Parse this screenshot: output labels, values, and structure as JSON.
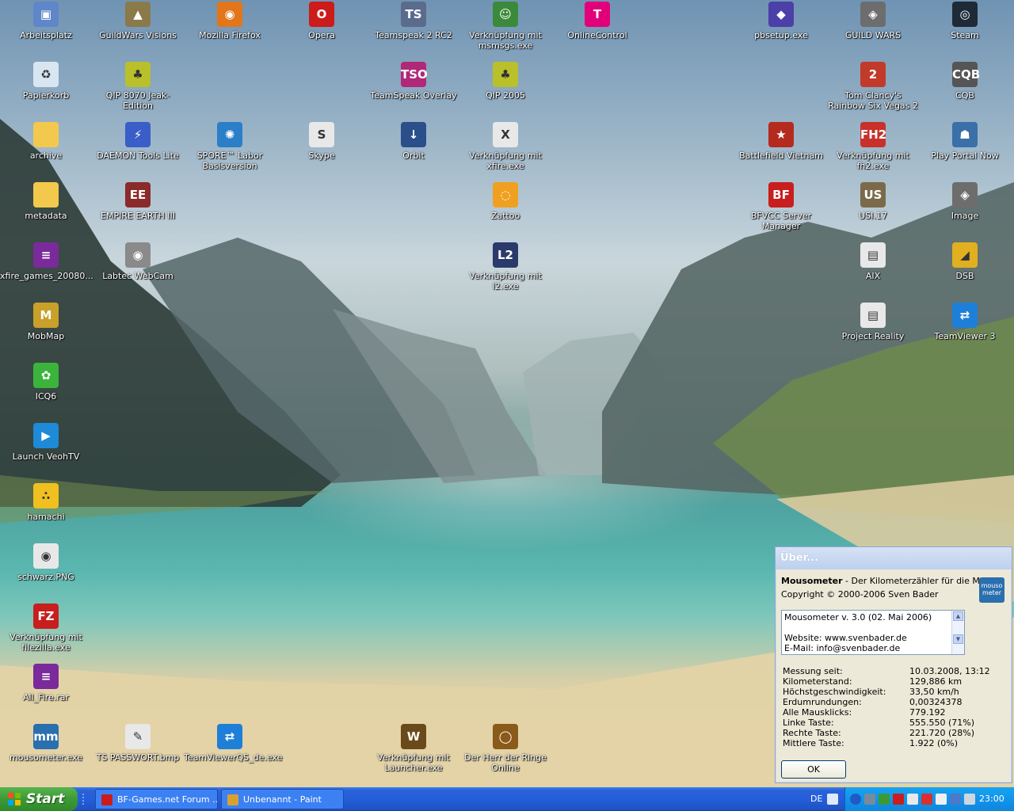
{
  "desktop": {
    "icons": [
      {
        "label": "Arbeitsplatz",
        "icon": "my-computer-icon",
        "glyph": "▣",
        "color": "#5f86c8"
      },
      {
        "label": "GuildWars Visions",
        "icon": "guildwars-visions-icon",
        "glyph": "▲",
        "color": "#8a7a4a"
      },
      {
        "label": "Mozilla Firefox",
        "icon": "firefox-icon",
        "glyph": "◉",
        "color": "#e2761b"
      },
      {
        "label": "Opera",
        "icon": "opera-icon",
        "glyph": "O",
        "color": "#cc1b1b"
      },
      {
        "label": "Teamspeak 2 RC2",
        "icon": "teamspeak-icon",
        "glyph": "TS",
        "color": "#5a6b8c"
      },
      {
        "label": "Verknüpfung mit msmsgs.exe",
        "icon": "messenger-icon",
        "glyph": "☺",
        "color": "#3b8a3b"
      },
      {
        "label": "OnlineControl",
        "icon": "telekom-icon",
        "glyph": "T",
        "color": "#e2007a"
      },
      {
        "label": "pbsetup.exe",
        "icon": "pbsetup-icon",
        "glyph": "◆",
        "color": "#4b3fa8"
      },
      {
        "label": "GUILD WARS",
        "icon": "guild-wars-icon",
        "glyph": "◈",
        "color": "#6d6d6d"
      },
      {
        "label": "Steam",
        "icon": "steam-icon",
        "glyph": "◎",
        "color": "#1e2a38"
      },
      {
        "label": "Papierkorb",
        "icon": "recycle-bin-icon",
        "glyph": "♻",
        "color": "#d8e6f2"
      },
      {
        "label": "QIP 8070 Jeak-Edition",
        "icon": "qip-icon",
        "glyph": "♣",
        "color": "#b9c02a"
      },
      {
        "label": "TeamSpeak Overlay",
        "icon": "teamspeak-overlay-icon",
        "glyph": "TSO",
        "color": "#b02878"
      },
      {
        "label": "QIP 2005",
        "icon": "qip2005-icon",
        "glyph": "♣",
        "color": "#b9c02a"
      },
      {
        "label": "Tom Clancy's Rainbow Six Vegas 2",
        "icon": "rainbow-six-icon",
        "glyph": "2",
        "color": "#c23a2a"
      },
      {
        "label": "CQB",
        "icon": "cqb-icon",
        "glyph": "CQB",
        "color": "#555555"
      },
      {
        "label": "archive",
        "icon": "folder-icon",
        "glyph": "",
        "color": "#f2c94c"
      },
      {
        "label": "DAEMON Tools Lite",
        "icon": "daemon-tools-icon",
        "glyph": "⚡",
        "color": "#3a5ec8"
      },
      {
        "label": "SPORE™ Labor Basisversion",
        "icon": "spore-icon",
        "glyph": "✺",
        "color": "#2a7fc8"
      },
      {
        "label": "Skype",
        "icon": "skype-icon",
        "glyph": "S",
        "color": "#e8e8e8"
      },
      {
        "label": "Orbit",
        "icon": "orbit-icon",
        "glyph": "↓",
        "color": "#2b4f8a"
      },
      {
        "label": "Verknüpfung mit xfire.exe",
        "icon": "xfire-icon",
        "glyph": "X",
        "color": "#e8e8e8"
      },
      {
        "label": "Battlefield Vietnam",
        "icon": "battlefield-vietnam-icon",
        "glyph": "★",
        "color": "#b52a1e"
      },
      {
        "label": "Verknüpfung mit fh2.exe",
        "icon": "fh2-icon",
        "glyph": "FH2",
        "color": "#c8302a"
      },
      {
        "label": "Play Portal Now",
        "icon": "portal-icon",
        "glyph": "☗",
        "color": "#3a6fa8"
      },
      {
        "label": "metadata",
        "icon": "folder-icon",
        "glyph": "",
        "color": "#f2c94c"
      },
      {
        "label": "EMPIRE EARTH III",
        "icon": "empire-earth-icon",
        "glyph": "EE",
        "color": "#8a2a2a"
      },
      {
        "label": "Zattoo",
        "icon": "zattoo-icon",
        "glyph": "◌",
        "color": "#f0a020"
      },
      {
        "label": "BFVCC Server Manager",
        "icon": "bfvcc-icon",
        "glyph": "BF",
        "color": "#c81e1e"
      },
      {
        "label": "USI.17",
        "icon": "usi-icon",
        "glyph": "US",
        "color": "#7a6a4a"
      },
      {
        "label": "Image",
        "icon": "image-icon",
        "glyph": "◈",
        "color": "#6d6d6d"
      },
      {
        "label": "xfire_games_20080...",
        "icon": "winrar-icon",
        "glyph": "≡",
        "color": "#7a2a9a"
      },
      {
        "label": "Labtec WebCam",
        "icon": "webcam-icon",
        "glyph": "◉",
        "color": "#8a8a8a"
      },
      {
        "label": "Verknüpfung mit l2.exe",
        "icon": "lineage2-icon",
        "glyph": "L2",
        "color": "#2a3a6a"
      },
      {
        "label": "AIX",
        "icon": "aix-icon",
        "glyph": "▤",
        "color": "#e8e8e8"
      },
      {
        "label": "DSB",
        "icon": "dsb-icon",
        "glyph": "◢",
        "color": "#e0b020"
      },
      {
        "label": "MobMap",
        "icon": "mobmap-icon",
        "glyph": "M",
        "color": "#c8a02a"
      },
      {
        "label": "Project Reality",
        "icon": "project-reality-icon",
        "glyph": "▤",
        "color": "#e8e8e8"
      },
      {
        "label": "TeamViewer 3",
        "icon": "teamviewer-icon",
        "glyph": "⇄",
        "color": "#1e7fd8"
      },
      {
        "label": "ICQ6",
        "icon": "icq-icon",
        "glyph": "✿",
        "color": "#3cb43c"
      },
      {
        "label": "Launch VeohTV",
        "icon": "veohtv-icon",
        "glyph": "▶",
        "color": "#1e8ad8"
      },
      {
        "label": "hamachi",
        "icon": "hamachi-icon",
        "glyph": "∴",
        "color": "#f0c020"
      },
      {
        "label": "schwarz.PNG",
        "icon": "png-file-icon",
        "glyph": "◉",
        "color": "#e8e8e8"
      },
      {
        "label": "Verknüpfung mit filezilla.exe",
        "icon": "filezilla-icon",
        "glyph": "FZ",
        "color": "#c81e1e"
      },
      {
        "label": "All_Fire.rar",
        "icon": "winrar-icon",
        "glyph": "≡",
        "color": "#7a2a9a"
      },
      {
        "label": "mousometer.exe",
        "icon": "mousometer-icon",
        "glyph": "mm",
        "color": "#2a6fae"
      },
      {
        "label": "TS PASSWORT.bmp",
        "icon": "bmp-file-icon",
        "glyph": "✎",
        "color": "#e8e8e8"
      },
      {
        "label": "TeamViewerQS_de.exe",
        "icon": "teamviewer-qs-icon",
        "glyph": "⇄",
        "color": "#1e7fd8"
      },
      {
        "label": "Verknüpfung mit Launcher.exe",
        "icon": "wow-icon",
        "glyph": "W",
        "color": "#6a4a1a"
      },
      {
        "label": "Der Herr der Ringe Online",
        "icon": "lotro-icon",
        "glyph": "◯",
        "color": "#8a5a1a"
      }
    ]
  },
  "about_dialog": {
    "title": "Über...",
    "app_name": "Mousometer",
    "app_tagline": " - Der Kilometerzähler für die Maus",
    "copyright": "Copyright © 2000-2006 Sven Bader",
    "logo_text": "mouso meter",
    "info_lines": [
      "Mousometer v. 3.0 (02. Mai 2006)",
      "",
      "Website: www.svenbader.de",
      "E-Mail: info@svenbader.de"
    ],
    "stats": [
      {
        "key": "Messung seit:",
        "value": "10.03.2008, 13:12"
      },
      {
        "key": "Kilometerstand:",
        "value": "129,886 km"
      },
      {
        "key": "Höchstgeschwindigkeit:",
        "value": "33,50 km/h"
      },
      {
        "key": "Erdumrundungen:",
        "value": "0,00324378"
      },
      {
        "key": "Alle Mausklicks:",
        "value": "779.192"
      },
      {
        "key": "Linke Taste:",
        "value": "555.550 (71%)"
      },
      {
        "key": "Rechte Taste:",
        "value": "221.720 (28%)"
      },
      {
        "key": "Mittlere Taste:",
        "value": "1.922 (0%)"
      }
    ],
    "ok_label": "OK"
  },
  "taskbar": {
    "start_label": "Start",
    "tasks": [
      {
        "label": "BF-Games.net Forum ...",
        "icon": "opera-icon",
        "color": "#cc1b1b"
      },
      {
        "label": "Unbenannt - Paint",
        "icon": "paint-icon",
        "color": "#d8a030"
      }
    ],
    "language": "DE",
    "clock": "23:00"
  },
  "colors": {
    "taskbar": "#245edb",
    "start": "#3c9a35",
    "tray": "#0f86df",
    "dialog": "#ece9d8"
  }
}
